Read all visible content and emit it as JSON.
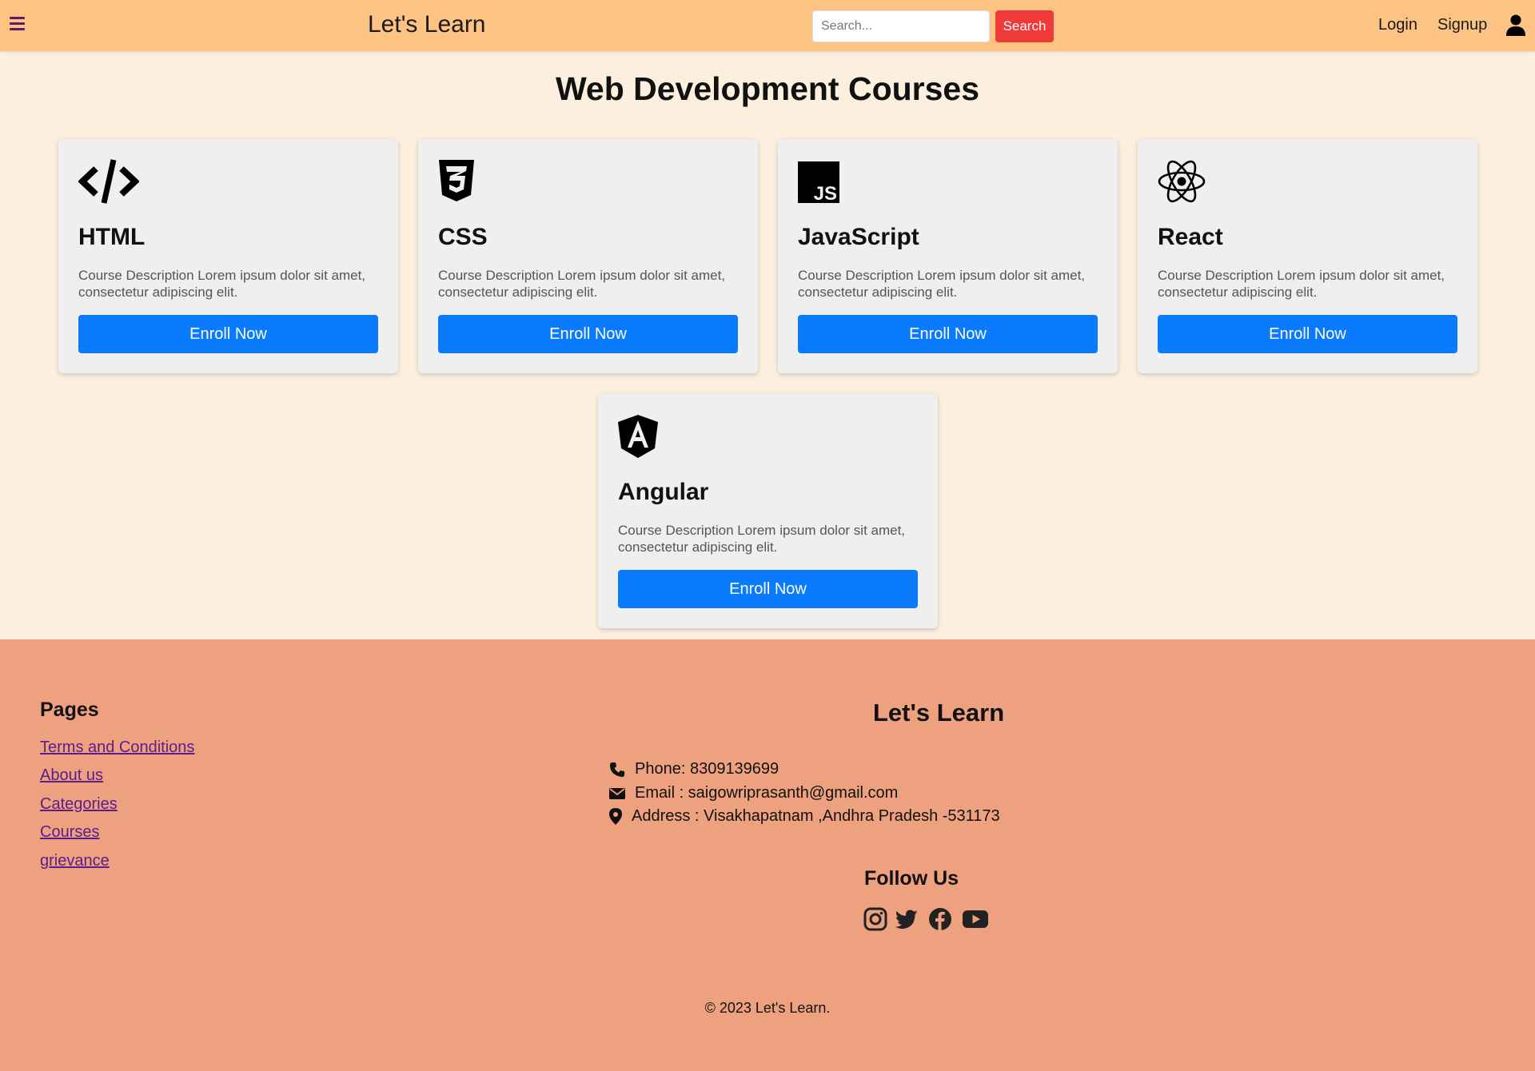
{
  "navbar": {
    "brand": "Let's Learn",
    "search_placeholder": "Search...",
    "search_button": "Search",
    "login": "Login",
    "signup": "Signup",
    "background": "#fdc382"
  },
  "main": {
    "title": "Web Development Courses",
    "enroll_label": "Enroll Now",
    "accent": "#0a7bff",
    "courses": [
      {
        "icon": "code-icon",
        "title": "HTML",
        "description": "Course Description Lorem ipsum dolor sit amet, consectetur adipiscing elit."
      },
      {
        "icon": "css3-icon",
        "title": "CSS",
        "description": "Course Description Lorem ipsum dolor sit amet, consectetur adipiscing elit."
      },
      {
        "icon": "javascript-icon",
        "title": "JavaScript",
        "description": "Course Description Lorem ipsum dolor sit amet, consectetur adipiscing elit."
      },
      {
        "icon": "react-icon",
        "title": "React",
        "description": "Course Description Lorem ipsum dolor sit amet, consectetur adipiscing elit."
      },
      {
        "icon": "angular-icon",
        "title": "Angular",
        "description": "Course Description Lorem ipsum dolor sit amet, consectetur adipiscing elit."
      }
    ]
  },
  "footer": {
    "pages_heading": "Pages",
    "links": [
      "Terms and Conditions",
      "About us",
      "Categories",
      "Courses",
      "grievance"
    ],
    "brand": "Let's Learn",
    "phone": "Phone: 8309139699",
    "email": "Email : saigowriprasanth@gmail.com",
    "address": "Address : Visakhapatnam ,Andhra Pradesh -531173",
    "follow_heading": "Follow Us",
    "social": [
      "instagram-icon",
      "twitter-icon",
      "facebook-icon",
      "youtube-icon"
    ],
    "copyright": "© 2023 Let's Learn.",
    "background": "#eea17e"
  }
}
